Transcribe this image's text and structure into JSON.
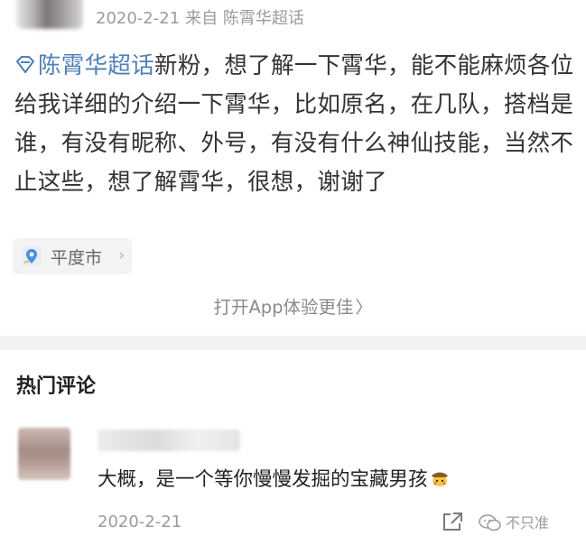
{
  "post": {
    "date": "2020-2-21",
    "source": "来自 陈霄华超话",
    "topic_link": "陈霄华超话",
    "body_text": "新粉，想了解一下霄华，能不能麻烦各位给我详细的介绍一下霄华，比如原名，在几队，搭档是谁，有没有昵称、外号，有没有什么神仙技能，当然不止这些，想了解霄华，很想，谢谢了",
    "location": "平度市",
    "open_app_label": "打开App体验更佳",
    "open_app_chevron": "〉"
  },
  "hot_comments": {
    "title": "热门评论",
    "items": [
      {
        "text": "大概，是一个等你慢慢发掘的宝藏男孩",
        "time": "2020-2-21"
      }
    ]
  },
  "watermark": {
    "text": "不只准"
  },
  "colors": {
    "link": "#4f7fb8",
    "meta_gray": "#9b9b9b",
    "divider": "#f2f2f2"
  },
  "icons": {
    "topic": "super-topic-diamond-icon",
    "location": "location-pin-icon",
    "share": "share-icon",
    "emoji": "pikachu-detective-emoji"
  }
}
